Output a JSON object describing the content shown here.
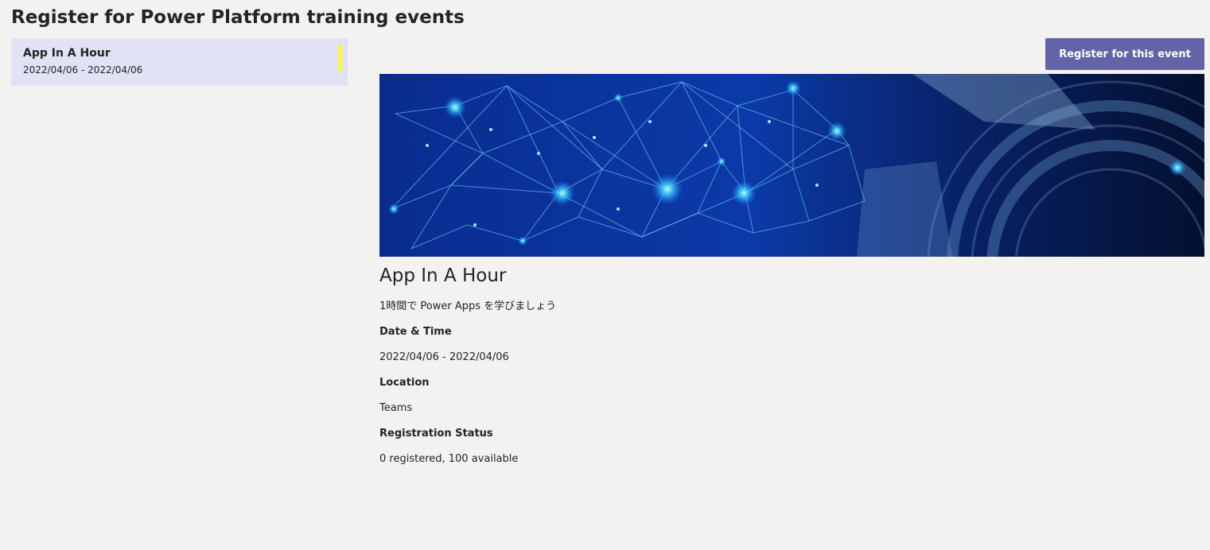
{
  "page": {
    "title": "Register for Power Platform training events"
  },
  "event_list": {
    "items": [
      {
        "title": "App In A Hour",
        "date_range": "2022/04/06 - 2022/04/06"
      }
    ]
  },
  "actions": {
    "register_label": "Register for this event"
  },
  "event_detail": {
    "title": "App In A Hour",
    "description": "1時間で Power Apps を学びましょう",
    "date_time_label": "Date & Time",
    "date_time_value": "2022/04/06 - 2022/04/06",
    "location_label": "Location",
    "location_value": "Teams",
    "registration_status_label": "Registration Status",
    "registration_status_value": "0 registered, 100 available"
  },
  "colors": {
    "background": "#f3f2f1",
    "selected_item": "#e2e2f6",
    "selected_marker": "#ffff00",
    "accent_button": "#6264a7",
    "text": "#252423"
  }
}
